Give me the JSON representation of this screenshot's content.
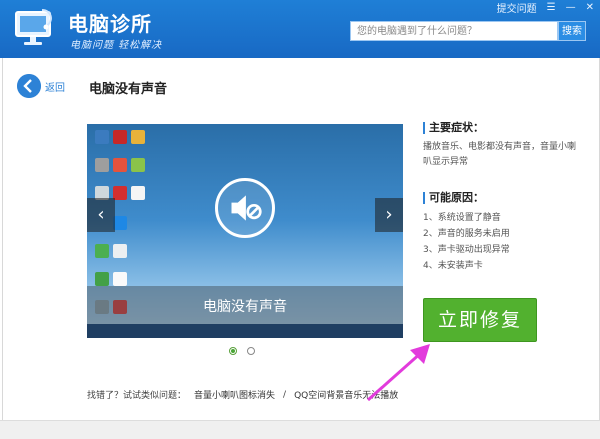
{
  "header": {
    "app_name": "电脑诊所",
    "slogan": "电脑问题 轻松解决",
    "feedback": "提交问题",
    "menu_glyph": "☰",
    "minimize_glyph": "—",
    "close_glyph": "✕",
    "search_placeholder": "您的电脑遇到了什么问题？",
    "search_button": "搜索"
  },
  "nav": {
    "back_label": "返回",
    "page_title": "电脑没有声音"
  },
  "preview": {
    "caption": "电脑没有声音",
    "prev_glyph": "‹",
    "next_glyph": "›",
    "slides": 2,
    "active_slide": 1
  },
  "side": {
    "symptoms_title": "主要症状：",
    "symptoms_text": "播放音乐、电影都没有声音，音量小喇叭显示异常",
    "causes_title": "可能原因：",
    "causes": [
      "1、系统设置了静音",
      "2、声音的服务未启用",
      "3、声卡驱动出现异常",
      "4、未安装声卡"
    ]
  },
  "fix_button": "立即修复",
  "bottom": {
    "prompt": "找错了？试试类似问题：",
    "link1": "音量小喇叭图标消失",
    "sep": "/",
    "link2": "QQ空间背景音乐无法播放"
  },
  "colors": {
    "header": "#1a72cc",
    "accent": "#2d82d6",
    "fix": "#52b12f",
    "annotation": "#e23bdc"
  }
}
